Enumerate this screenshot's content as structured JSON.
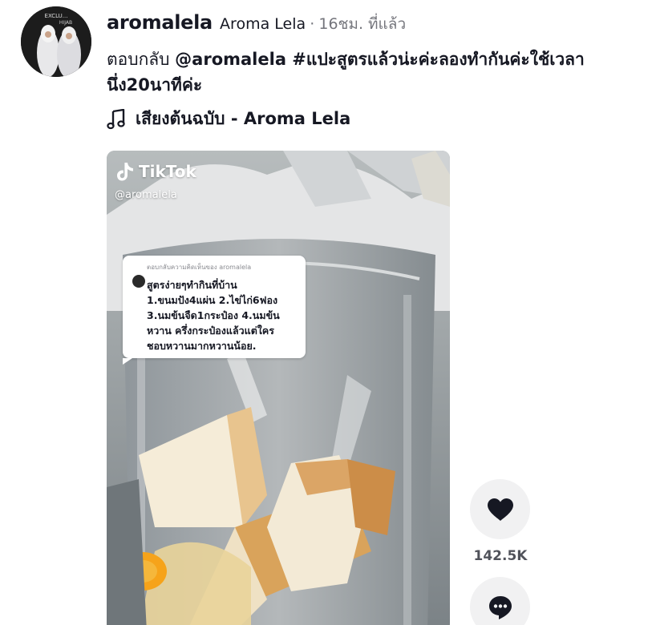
{
  "author": {
    "username": "aromalela",
    "nickname": "Aroma Lela",
    "separator": "·",
    "time_ago": "16ชม. ที่แล้ว",
    "avatar_text_top": "EXCLU...",
    "avatar_text_sub": "HIJAB"
  },
  "caption": {
    "prefix": "ตอบกลับ ",
    "mention": "@aromalela",
    "hashtag": " #แปะสูตรแล้วน่ะค่ะลองทำกันค่ะใช้เวลา",
    "rest": "นึ่ง20นาทีค่ะ"
  },
  "music": {
    "icon": "music-note-icon",
    "title": "เสียงต้นฉบับ - Aroma Lela"
  },
  "video": {
    "watermark": "TikTok",
    "handle": "@aromalela",
    "reply_card": {
      "header": "ตอบกลับความคิดเห็นของ aromalela",
      "body": "สูตรง่ายๆทำกินที่บ้าน\n1.ขนมปัง4แผ่น 2.ไข่ไก่6ฟอง\n3.นมข้นจืด1กระป๋อง 4.นมข้น\nหวาน ครึ่งกระป๋องแล้วแต่ใคร\nชอบหวานมากหวานน้อย."
    }
  },
  "actions": {
    "like_icon": "heart-icon",
    "like_count": "142.5K",
    "comment_icon": "comment-icon"
  }
}
